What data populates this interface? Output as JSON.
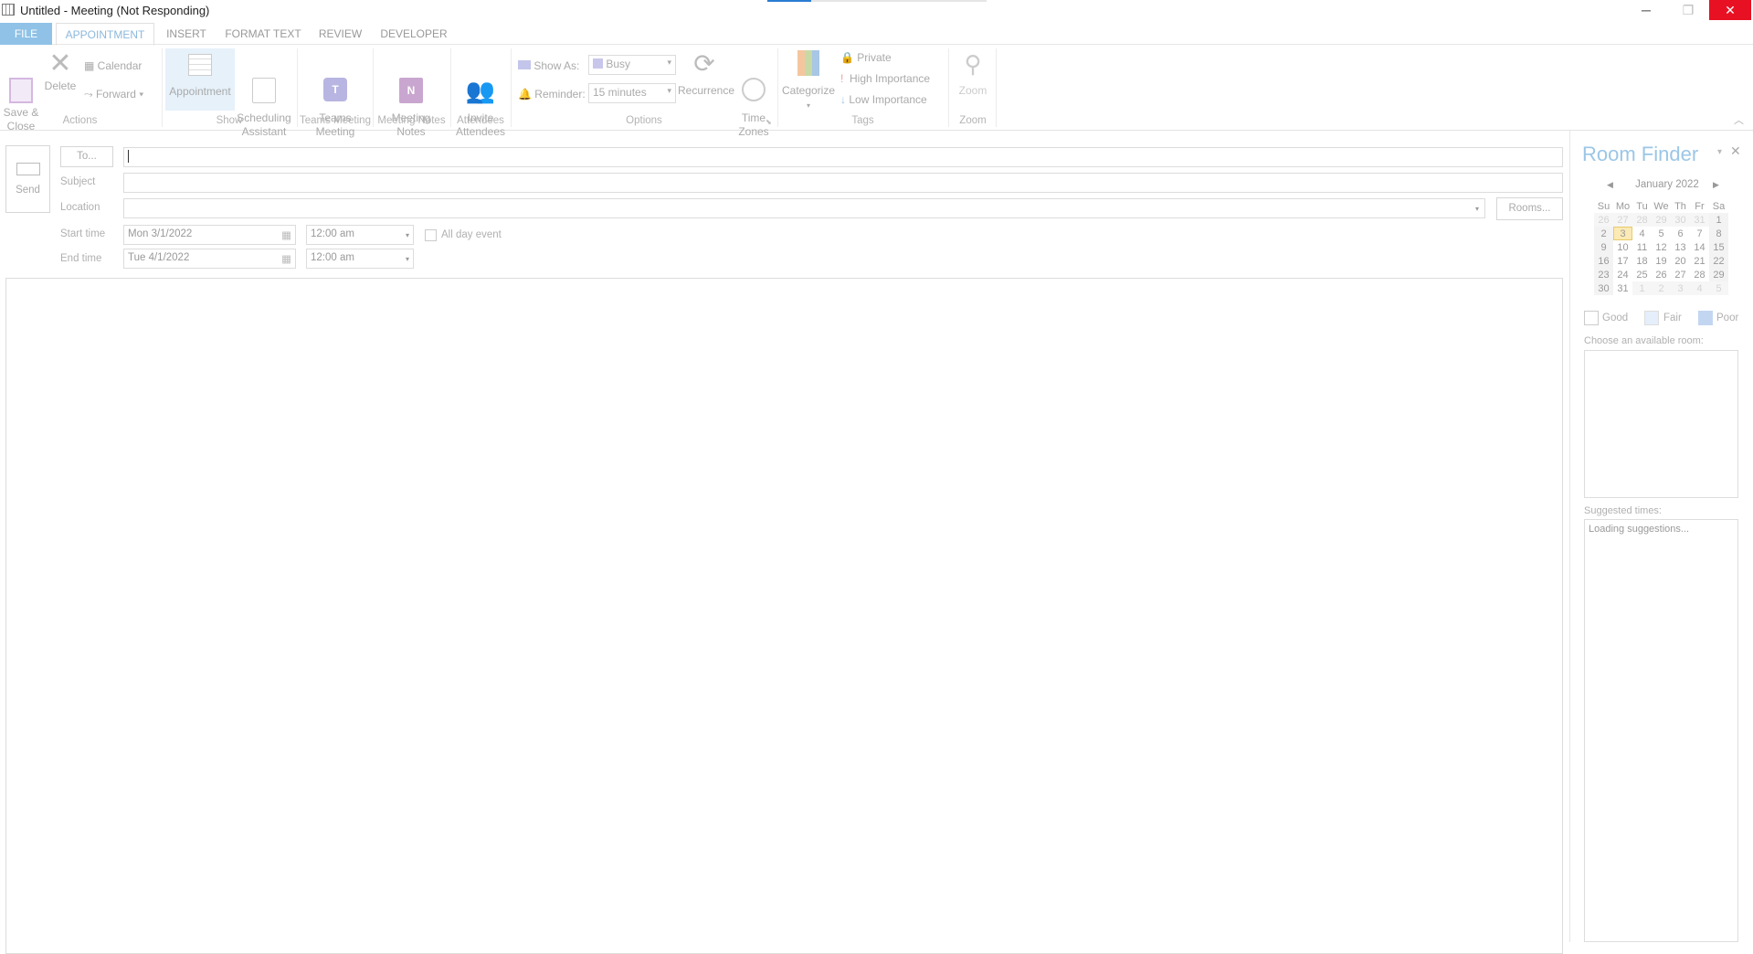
{
  "window": {
    "title": "Untitled - Meeting  (Not Responding)",
    "minimize": "─",
    "restore": "❐",
    "close": "✕"
  },
  "tabs": [
    {
      "label": "FILE"
    },
    {
      "label": "APPOINTMENT"
    },
    {
      "label": "INSERT"
    },
    {
      "label": "FORMAT TEXT"
    },
    {
      "label": "REVIEW"
    },
    {
      "label": "DEVELOPER"
    }
  ],
  "ribbon": {
    "save_close": "Save &\nClose",
    "delete": "Delete",
    "calendar": "Calendar",
    "forward": "Forward",
    "appointment": "Appointment",
    "scheduling": "Scheduling\nAssistant",
    "teams": "Teams\nMeeting",
    "notes": "Meeting\nNotes",
    "invite": "Invite\nAttendees",
    "show_as_label": "Show As:",
    "show_as_value": "Busy",
    "reminder_label": "Reminder:",
    "reminder_value": "15 minutes",
    "recurrence": "Recurrence",
    "time_zones": "Time\nZones",
    "categorize": "Categorize",
    "private": "Private",
    "high": "High Importance",
    "low": "Low Importance",
    "zoom": "Zoom",
    "groups": {
      "actions": "Actions",
      "show": "Show",
      "teams": "Teams Meeting",
      "notes": "Meeting Notes",
      "attendees": "Attendees",
      "options": "Options",
      "tags": "Tags",
      "zoom": "Zoom"
    }
  },
  "form": {
    "send": "Send",
    "to": "To...",
    "to_value": "",
    "subject_label": "Subject",
    "subject_value": "",
    "location_label": "Location",
    "location_value": "",
    "rooms": "Rooms...",
    "start_label": "Start time",
    "start_date": "Mon 3/1/2022",
    "start_time": "12:00 am",
    "all_day": "All day event",
    "end_label": "End time",
    "end_date": "Tue 4/1/2022",
    "end_time": "12:00 am",
    "body": ""
  },
  "room_finder": {
    "title": "Room Finder",
    "month": "January 2022",
    "days": [
      "Su",
      "Mo",
      "Tu",
      "We",
      "Th",
      "Fr",
      "Sa"
    ],
    "weeks": [
      [
        "26",
        "27",
        "28",
        "29",
        "30",
        "31",
        "1"
      ],
      [
        "2",
        "3",
        "4",
        "5",
        "6",
        "7",
        "8"
      ],
      [
        "9",
        "10",
        "11",
        "12",
        "13",
        "14",
        "15"
      ],
      [
        "16",
        "17",
        "18",
        "19",
        "20",
        "21",
        "22"
      ],
      [
        "23",
        "24",
        "25",
        "26",
        "27",
        "28",
        "29"
      ],
      [
        "30",
        "31",
        "1",
        "2",
        "3",
        "4",
        "5"
      ]
    ],
    "legend": [
      "Good",
      "Fair",
      "Poor"
    ],
    "choose_label": "Choose an available room:",
    "suggested_label": "Suggested times:",
    "loading": "Loading suggestions..."
  },
  "colors": {
    "accent": "#8fc2e6",
    "fair": "#e5eefb",
    "poor": "#c3d6f1",
    "today": "#fbeab5",
    "close": "#e81123"
  }
}
